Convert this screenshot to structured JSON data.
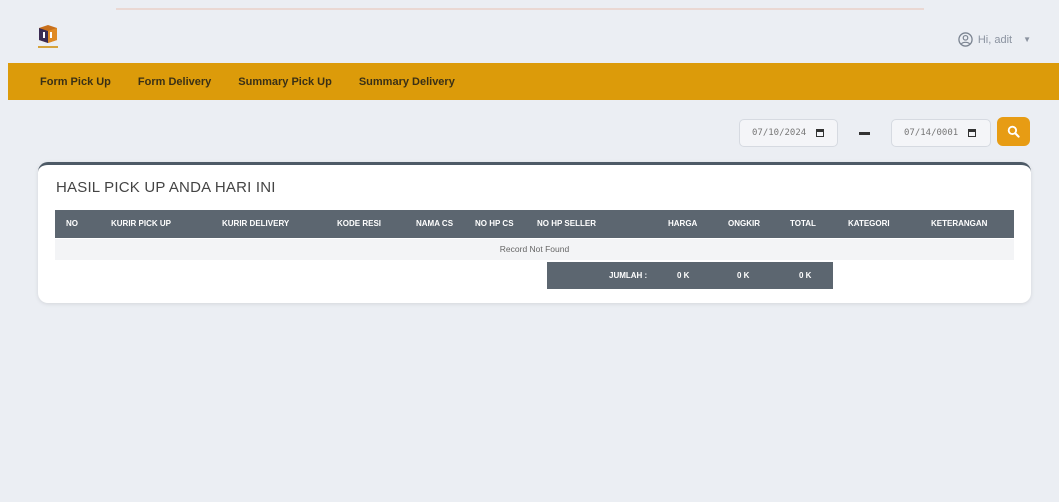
{
  "user": {
    "greeting": "Hi, adit",
    "avatar_icon": "user-circle-icon"
  },
  "nav": {
    "items": [
      {
        "label": "Form Pick Up"
      },
      {
        "label": "Form Delivery"
      },
      {
        "label": "Summary Pick Up"
      },
      {
        "label": "Summary Delivery"
      }
    ]
  },
  "filter": {
    "date_from": "07/10/2024",
    "date_to": "07/14/0001",
    "search_icon": "search-icon"
  },
  "card": {
    "title": "HASIL PICK UP ANDA HARI INI",
    "columns": [
      "NO",
      "KURIR PICK UP",
      "KURIR DELIVERY",
      "KODE RESI",
      "NAMA CS",
      "NO HP CS",
      "NO HP SELLER",
      "HARGA",
      "ONGKIR",
      "TOTAL",
      "KATEGORI",
      "KETERANGAN"
    ],
    "empty_message": "Record Not Found",
    "summary": {
      "label": "JUMLAH :",
      "harga": "0 K",
      "ongkir": "0 K",
      "total": "0 K"
    }
  },
  "colors": {
    "accent": "#dc9b0a",
    "table_header": "#5c6670",
    "card_border": "#4d5a66",
    "search_button": "#e79c14"
  }
}
